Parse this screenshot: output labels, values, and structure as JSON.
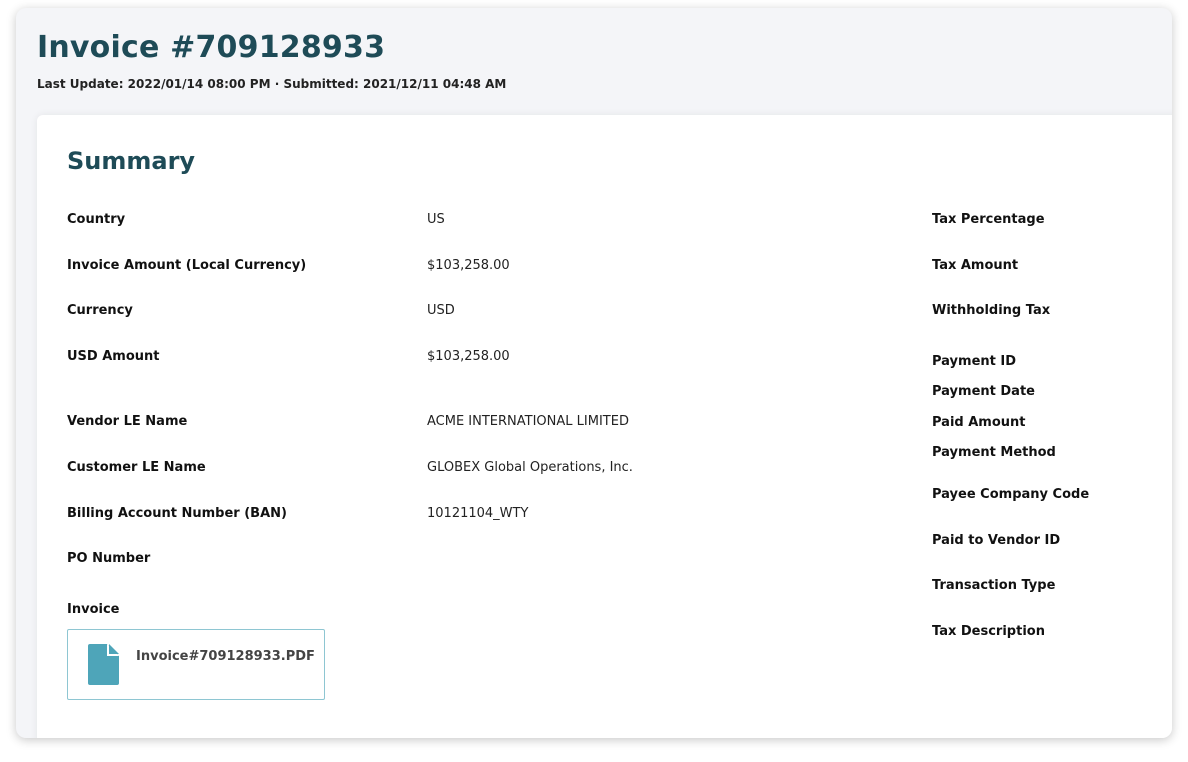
{
  "header": {
    "title": "Invoice #709128933",
    "meta": "Last Update: 2022/01/14 08:00 PM · Submitted: 2021/12/11 04:48 AM"
  },
  "summary": {
    "title": "Summary",
    "left_fields": [
      {
        "label": "Country",
        "value": "US"
      },
      {
        "label": "Invoice Amount (Local Currency)",
        "value": "$103,258.00"
      },
      {
        "label": "Currency",
        "value": "USD"
      },
      {
        "label": "USD Amount",
        "value": "$103,258.00"
      },
      {
        "label": "Vendor LE Name",
        "value": "ACME INTERNATIONAL LIMITED"
      },
      {
        "label": "Customer LE Name",
        "value": "GLOBEX Global Operations, Inc."
      },
      {
        "label": "Billing Account Number (BAN)",
        "value": "10121104_WTY"
      },
      {
        "label": "PO Number",
        "value": ""
      }
    ],
    "invoice_label": "Invoice",
    "attachment": {
      "file_name": "Invoice#709128933.PDF",
      "icon": "file-icon",
      "icon_color": "#4ea5b9"
    },
    "right_fields": [
      {
        "label": "Tax Percentage"
      },
      {
        "label": "Tax Amount"
      },
      {
        "label": "Withholding Tax"
      },
      {
        "label": "Payment ID"
      },
      {
        "label": "Payment Date"
      },
      {
        "label": "Paid Amount"
      },
      {
        "label": "Payment Method"
      },
      {
        "label": "Payee Company Code"
      },
      {
        "label": "Paid to Vendor ID"
      },
      {
        "label": "Transaction Type"
      },
      {
        "label": "Tax Description"
      }
    ]
  },
  "colors": {
    "accent": "#1e4b57",
    "border": "#8ec6d2"
  }
}
